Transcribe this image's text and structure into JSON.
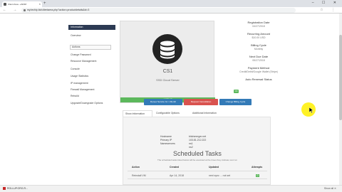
{
  "browser": {
    "tab_title": "Client Area - eNOM",
    "url": "my.techip.biz/clientarea.php?action=productdetails&id=3",
    "new_tab": "+",
    "window_controls": "– ☐ ✕",
    "nav_buttons": "← → ⟳",
    "toolbar_icons": "☆ ⋮"
  },
  "sidebar": {
    "header": "Information",
    "items": [
      {
        "label": "Overview"
      },
      {
        "label": "Actions"
      },
      {
        "label": "Change Password"
      },
      {
        "label": "Resource Management"
      },
      {
        "label": "Console"
      },
      {
        "label": "Usage Statistics"
      },
      {
        "label": "IP management"
      },
      {
        "label": "Firewall Management"
      },
      {
        "label": "Rebuild"
      },
      {
        "label": "Upgrade/Downgrade Options"
      }
    ]
  },
  "product": {
    "name": "CS1",
    "description": "SSD Cloud Server",
    "status": "ACTIVE"
  },
  "info": [
    {
      "label": "Registration Date",
      "value": "04/27/2018"
    },
    {
      "label": "Recurring Amount",
      "value": "$10.00 USD"
    },
    {
      "label": "Billing Cycle",
      "value": "Monthly"
    },
    {
      "label": "Next Due Date",
      "value": "05/27/2018"
    },
    {
      "label": "Payment Method",
      "value": "Credit/Debit/Google Wallet (Stripe)"
    },
    {
      "label": "Auto Renewal Status",
      "value": ""
    }
  ],
  "auto_renewal_badge": "ON",
  "buttons": {
    "renew": "Renew Service for 1 Month",
    "cancel": "Request Cancellation",
    "billing": "Change Billing Cycle"
  },
  "tabs": [
    "Show information",
    "Configurable Options",
    "Additional Information"
  ],
  "details": [
    {
      "key": "Hostname",
      "value": "bitchmerger.net"
    },
    {
      "key": "Primary IP",
      "value": "103.81.212.222"
    },
    {
      "key": "Nameservers",
      "value": "ns1"
    },
    {
      "key": "",
      "value": "ns2"
    }
  ],
  "scheduled": {
    "title": "Scheduled Tasks",
    "subtitle": "The scheduled tasks listed below will be executed at the times they indicate next run",
    "columns": [
      "Action",
      "Created",
      "Updated",
      "Attempts"
    ],
    "rows": [
      {
        "action": "Reinstall VM",
        "created": "Apr 14, 2018",
        "updated": "next sync ... not set",
        "attempts": "0"
      }
    ]
  },
  "download": {
    "file": "ROLLUP.ORG.R..."
  },
  "statusbar_right": "Show all ✕"
}
